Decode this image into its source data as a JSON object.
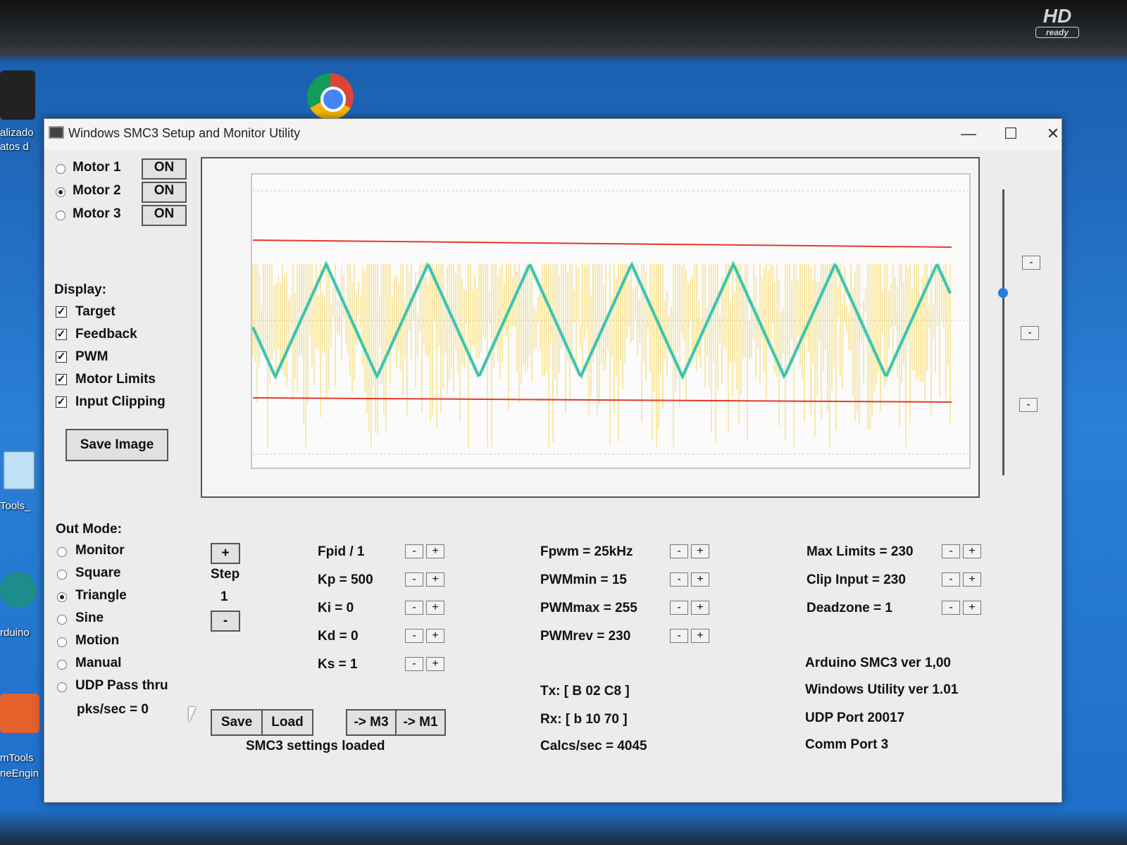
{
  "window": {
    "title": "Windows SMC3 Setup and Monitor Utility"
  },
  "titlebar": {
    "minimize": "—",
    "maximize": "☐",
    "close": "✕"
  },
  "monitor_badge": {
    "big": "HD",
    "small": "ready"
  },
  "desktop": {
    "labels": [
      "alizado",
      "atos d",
      "Tools_",
      "rduino",
      "mTools",
      "neEngin"
    ]
  },
  "motors": [
    {
      "label": "Motor 1",
      "button": "ON",
      "selected": false
    },
    {
      "label": "Motor 2",
      "button": "ON",
      "selected": true
    },
    {
      "label": "Motor 3",
      "button": "ON",
      "selected": false
    }
  ],
  "display": {
    "heading": "Display:",
    "items": [
      {
        "label": "Target",
        "checked": true
      },
      {
        "label": "Feedback",
        "checked": true
      },
      {
        "label": "PWM",
        "checked": true
      },
      {
        "label": "Motor Limits",
        "checked": true
      },
      {
        "label": "Input Clipping",
        "checked": true
      }
    ],
    "save_image": "Save Image"
  },
  "out_mode": {
    "heading": "Out Mode:",
    "items": [
      {
        "label": "Monitor",
        "selected": false
      },
      {
        "label": "Square",
        "selected": false
      },
      {
        "label": "Triangle",
        "selected": true
      },
      {
        "label": "Sine",
        "selected": false
      },
      {
        "label": "Motion",
        "selected": false
      },
      {
        "label": "Manual",
        "selected": false
      },
      {
        "label": "UDP Pass thru",
        "selected": false
      }
    ],
    "pks": "pks/sec = 0"
  },
  "step": {
    "plus": "+",
    "label": "Step",
    "value": "1",
    "minus": "-"
  },
  "pid": [
    {
      "label": "Fpid / 1"
    },
    {
      "label": "Kp = 500"
    },
    {
      "label": "Ki = 0"
    },
    {
      "label": "Kd = 0"
    },
    {
      "label": "Ks = 1"
    }
  ],
  "pwm": [
    {
      "label": "Fpwm = 25kHz"
    },
    {
      "label": "PWMmin = 15"
    },
    {
      "label": "PWMmax = 255"
    },
    {
      "label": "PWMrev = 230"
    }
  ],
  "limits": [
    {
      "label": "Max Limits = 230"
    },
    {
      "label": "Clip Input = 230"
    },
    {
      "label": "Deadzone = 1"
    }
  ],
  "minus_plus": {
    "minus": "-",
    "plus": "+"
  },
  "actions": {
    "save": "Save",
    "load": "Load",
    "to_m3": "-> M3",
    "to_m1": "-> M1",
    "status": "SMC3 settings loaded"
  },
  "comm": {
    "tx": "Tx: [ B 02 C8 ]",
    "rx": "Rx: [ b 10 70 ]",
    "calcs": "Calcs/sec = 4045"
  },
  "info": {
    "arduino": "Arduino SMC3 ver 1,00",
    "utility": "Windows Utility ver 1.01",
    "udp": "UDP Port 20017",
    "comm_port": "Comm Port 3"
  },
  "side_buttons": [
    "-",
    "-",
    "-"
  ],
  "colors": {
    "limit": "#e53a2a",
    "target": "#2bb8d6",
    "feedback": "#8be08a",
    "pwm": "#f4cf40"
  },
  "chart_data": {
    "type": "line",
    "series": [],
    "triangle_peaks": 7,
    "triangle_troughs": 7,
    "limits": "upper and lower motor limits shown as red horizontal lines",
    "grid": true
  }
}
